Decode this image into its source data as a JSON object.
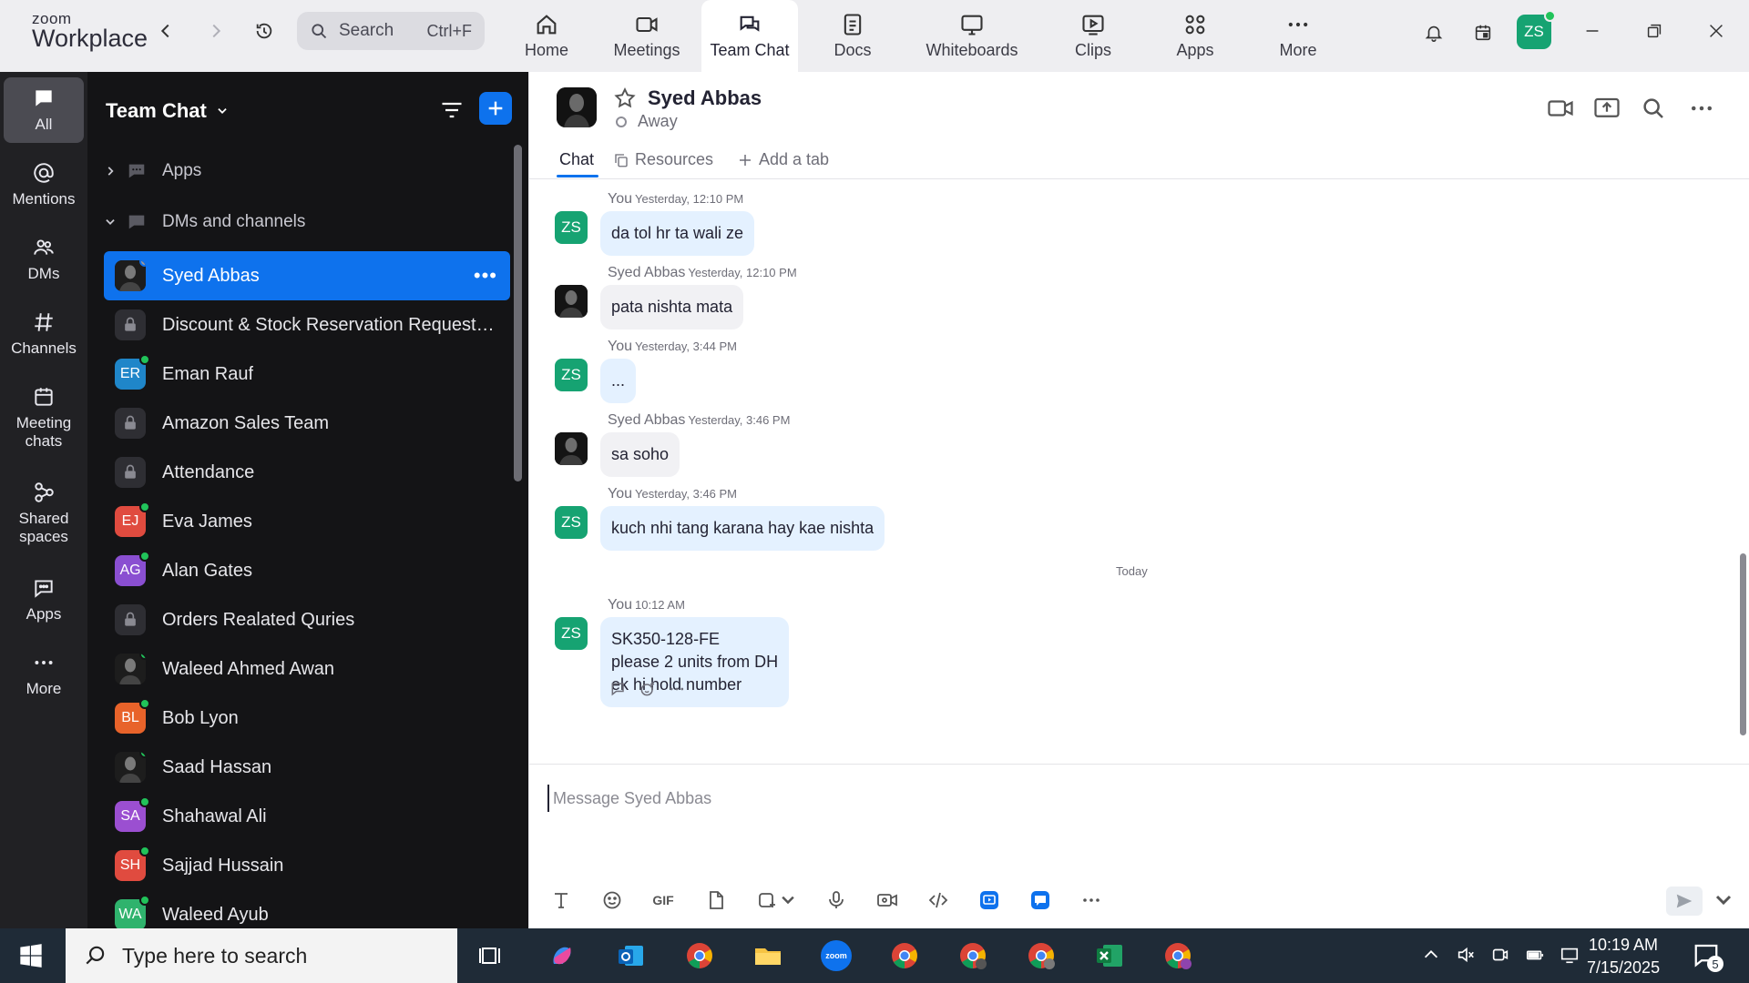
{
  "app": {
    "logo_line1": "zoom",
    "logo_line2": "Workplace",
    "search_placeholder": "Search",
    "search_shortcut": "Ctrl+F",
    "avatar_initials": "ZS",
    "nav_tabs": [
      {
        "label": "Home",
        "icon": "home-icon"
      },
      {
        "label": "Meetings",
        "icon": "video-icon"
      },
      {
        "label": "Team Chat",
        "icon": "chat-icon",
        "active": true
      },
      {
        "label": "Docs",
        "icon": "document-icon"
      },
      {
        "label": "Whiteboards",
        "icon": "whiteboard-icon"
      },
      {
        "label": "Clips",
        "icon": "clips-icon"
      },
      {
        "label": "Apps",
        "icon": "apps-icon"
      },
      {
        "label": "More",
        "icon": "more-icon"
      }
    ]
  },
  "rail": {
    "items": [
      {
        "label": "All",
        "icon": "chat-bubble-icon",
        "active": true
      },
      {
        "label": "Mentions",
        "icon": "at-icon"
      },
      {
        "label": "DMs",
        "icon": "people-icon"
      },
      {
        "label": "Channels",
        "icon": "hash-icon"
      },
      {
        "label": "Meeting chats",
        "icon": "calendar-icon"
      },
      {
        "label": "Shared spaces",
        "icon": "shared-spaces-icon"
      },
      {
        "label": "Apps",
        "icon": "apps-bubble-icon"
      },
      {
        "label": "More",
        "icon": "more-icon"
      }
    ]
  },
  "list": {
    "title": "Team Chat",
    "sections": {
      "apps": "Apps",
      "dms": "DMs and channels"
    },
    "items": [
      {
        "name": "Syed Abbas",
        "kind": "photo",
        "active": true,
        "status": "away"
      },
      {
        "name": "Discount & Stock Reservation Requests O...",
        "kind": "lock"
      },
      {
        "name": "Eman Rauf",
        "kind": "initials",
        "initials": "ER",
        "color": "#1f86c9",
        "status": "online"
      },
      {
        "name": "Amazon Sales Team",
        "kind": "lock"
      },
      {
        "name": "Attendance",
        "kind": "lock"
      },
      {
        "name": "Eva James",
        "kind": "initials",
        "initials": "EJ",
        "color": "#e04b3f",
        "status": "online"
      },
      {
        "name": "Alan Gates",
        "kind": "initials",
        "initials": "AG",
        "color": "#8a4fd1",
        "status": "online"
      },
      {
        "name": "Orders Realated Quries",
        "kind": "lock"
      },
      {
        "name": "Waleed Ahmed Awan",
        "kind": "photo",
        "status": "online"
      },
      {
        "name": "Bob Lyon",
        "kind": "initials",
        "initials": "BL",
        "color": "#e8632a",
        "status": "online"
      },
      {
        "name": "Saad Hassan",
        "kind": "photo",
        "status": "online"
      },
      {
        "name": "Shahawal Ali",
        "kind": "initials",
        "initials": "SA",
        "color": "#9b4fd1",
        "status": "online"
      },
      {
        "name": "Sajjad Hussain",
        "kind": "initials",
        "initials": "SH",
        "color": "#e04b3f",
        "status": "online"
      },
      {
        "name": "Waleed Ayub",
        "kind": "initials",
        "initials": "WA",
        "color": "#2fb36d",
        "status": "online"
      }
    ]
  },
  "chat": {
    "peer_name": "Syed Abbas",
    "peer_status": "Away",
    "tabs": {
      "chat": "Chat",
      "resources": "Resources",
      "add": "Add a tab"
    },
    "today_label": "Today",
    "messages": [
      {
        "sender": "You",
        "time": "Yesterday, 12:10 PM",
        "avatar": "ZS",
        "lines": [
          "da tol hr ta wali ze"
        ]
      },
      {
        "sender": "Syed Abbas",
        "time": "Yesterday, 12:10 PM",
        "avatar": "photo",
        "lines": [
          "pata nishta mata"
        ]
      },
      {
        "sender": "You",
        "time": "Yesterday, 3:44 PM",
        "avatar": "ZS",
        "lines": [
          "..."
        ]
      },
      {
        "sender": "Syed Abbas",
        "time": "Yesterday, 3:46 PM",
        "avatar": "photo",
        "lines": [
          "sa soho"
        ]
      },
      {
        "sender": "You",
        "time": "Yesterday, 3:46 PM",
        "avatar": "ZS",
        "lines": [
          "kuch nhi tang karana hay kae nishta"
        ]
      },
      {
        "sender": "You",
        "time": "10:12 AM",
        "avatar": "ZS",
        "lines": [
          "SK350-128-FE",
          "please 2 units from DH",
          "ek hi hold number"
        ]
      }
    ],
    "composer_placeholder": "Message Syed Abbas",
    "composer_gif": "GIF"
  },
  "taskbar": {
    "search_placeholder": "Type here to search",
    "time": "10:19 AM",
    "date": "7/15/2025",
    "notifications": "5"
  }
}
